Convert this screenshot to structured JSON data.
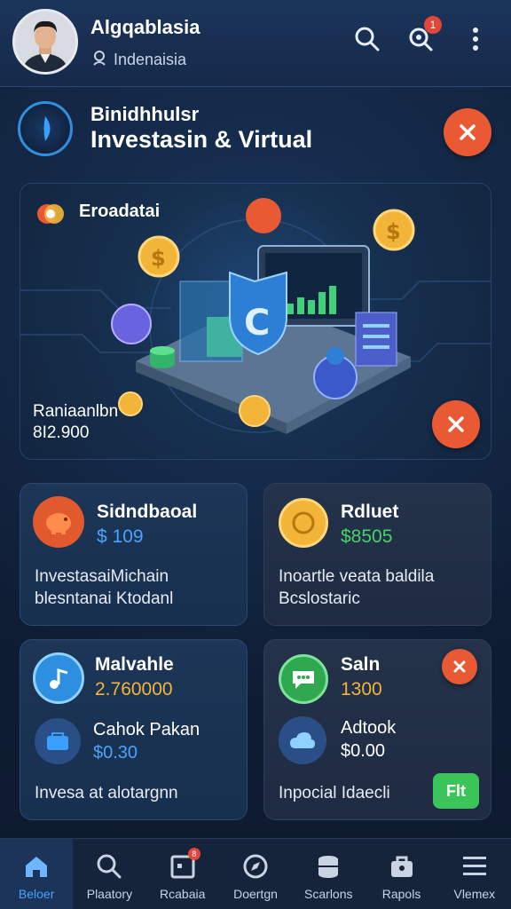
{
  "header": {
    "app_title": "Algqablasia",
    "location": "Indenaisia",
    "notification_badge": "1"
  },
  "banner": {
    "line1": "Binidhhulsr",
    "line2": "Investasin & Virtual"
  },
  "hero": {
    "title": "Eroadatai",
    "label": "Raniaanlbn",
    "value": "8I2.900"
  },
  "cards": [
    {
      "title": "Sidndbaoal",
      "amount": "$ 109",
      "desc1": "InvestasaiMichain",
      "desc2": "blesntanai Ktodanl",
      "amount_color": "#4aa3ff"
    },
    {
      "title": "Rdluet",
      "amount": "$8505",
      "desc1": "Inoartle veata baldila",
      "desc2": "Bcslostaric",
      "amount_color": "#47d36a"
    },
    {
      "title": "Malvahle",
      "amount": "2.760000",
      "sub_title": "Cahok Pakan",
      "sub_amount": "$0.30",
      "footer": "Invesa at alotargnn",
      "amount_color": "#f2b53a",
      "sub_amount_color": "#4aa3ff"
    },
    {
      "title": "Saln",
      "amount": "1300",
      "sub_title": "Adtook",
      "sub_amount": "$0.00",
      "footer": "Inpocial Idaecli",
      "pill": "Flt",
      "amount_color": "#f2b53a",
      "sub_amount_color": "#ffffff"
    }
  ],
  "nav": [
    {
      "label": "Beloer",
      "icon": "home-icon"
    },
    {
      "label": "Plaatory",
      "icon": "search-icon"
    },
    {
      "label": "Rcabaia",
      "icon": "calendar-icon",
      "badge": "8"
    },
    {
      "label": "Doertgn",
      "icon": "compass-icon"
    },
    {
      "label": "Scarlons",
      "icon": "database-icon"
    },
    {
      "label": "Rapols",
      "icon": "briefcase-icon"
    },
    {
      "label": "Vlemex",
      "icon": "menu-icon"
    }
  ],
  "colors": {
    "accent": "#4aa3ff",
    "close": "#e95a34",
    "green": "#47d36a",
    "gold": "#f2b53a"
  }
}
